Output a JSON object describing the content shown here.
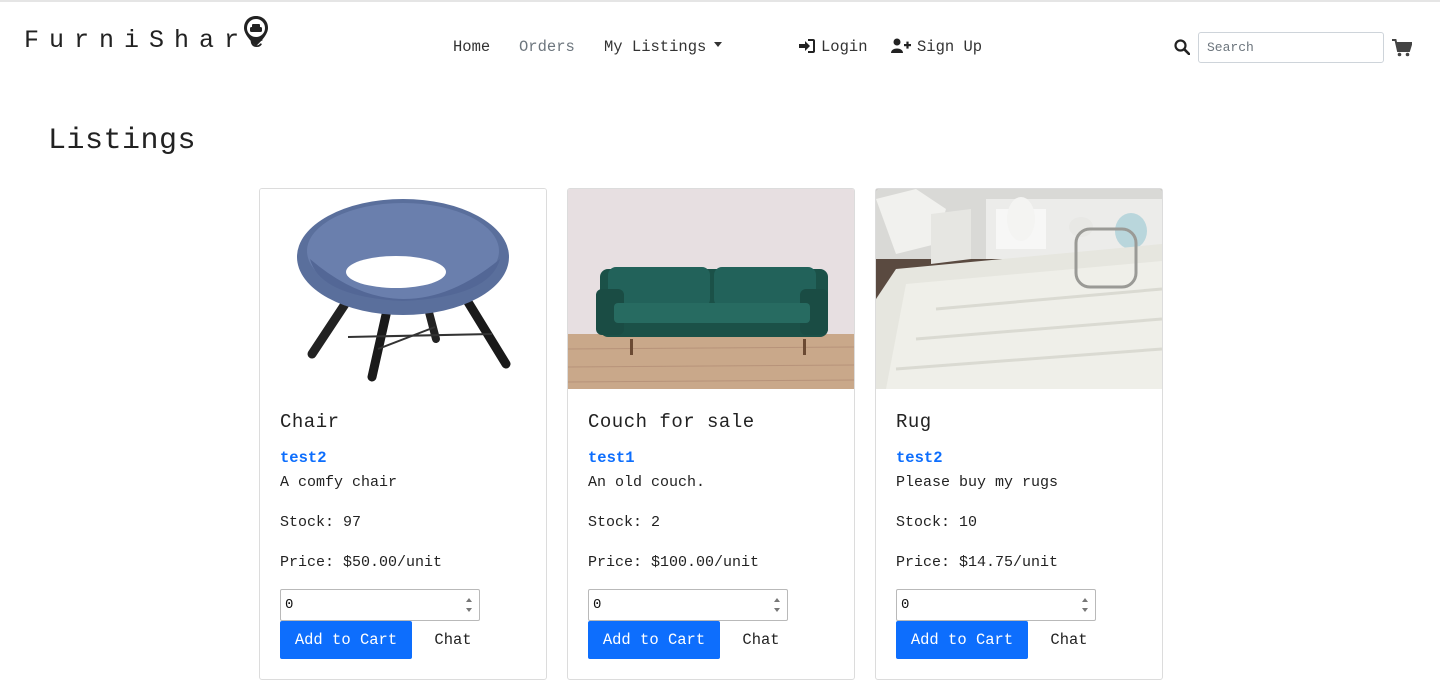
{
  "brand": {
    "name": "FurniShare",
    "logo_icon": "sofa-pin-icon"
  },
  "nav": {
    "home": "Home",
    "orders": "Orders",
    "my_listings": "My Listings",
    "login": "Login",
    "signup": "Sign Up",
    "search_placeholder": "Search"
  },
  "page": {
    "title": "Listings"
  },
  "listings": [
    {
      "title": "Chair",
      "seller": "test2",
      "description": "A comfy chair",
      "stock": "Stock: 97",
      "price": "Price: $50.00/unit",
      "qty": "0",
      "add_label": "Add to Cart",
      "chat_label": "Chat",
      "image": "blue-chair"
    },
    {
      "title": "Couch for sale",
      "seller": "test1",
      "description": "An old couch.",
      "stock": "Stock: 2",
      "price": "Price: $100.00/unit",
      "qty": "0",
      "add_label": "Add to Cart",
      "chat_label": "Chat",
      "image": "green-couch"
    },
    {
      "title": "Rug",
      "seller": "test2",
      "description": "Please buy my rugs",
      "stock": "Stock: 10",
      "price": "Price: $14.75/unit",
      "qty": "0",
      "add_label": "Add to Cart",
      "chat_label": "Chat",
      "image": "white-rug"
    }
  ],
  "colors": {
    "primary": "#0d6efd",
    "muted": "#6c757d"
  }
}
